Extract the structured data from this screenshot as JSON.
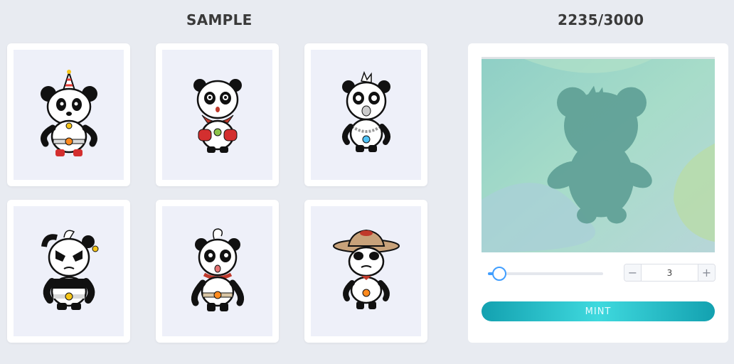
{
  "sample": {
    "title": "SAMPLE",
    "items": [
      {
        "name": "panda-party-hat"
      },
      {
        "name": "panda-red-gloves"
      },
      {
        "name": "panda-spiky-hair"
      },
      {
        "name": "panda-angry"
      },
      {
        "name": "panda-curl-hair"
      },
      {
        "name": "panda-straw-hat"
      }
    ]
  },
  "mint": {
    "supply_text": "2235/3000",
    "quantity": "3",
    "quantity_value": 3,
    "slider_fraction": 0.1,
    "decrement_label": "−",
    "increment_label": "+",
    "button_label": "MINT"
  },
  "colors": {
    "background": "#e8ebf1",
    "accent": "#409eff",
    "mint_gradient_start": "#13a1b0",
    "mint_gradient_mid": "#3fd9de"
  }
}
